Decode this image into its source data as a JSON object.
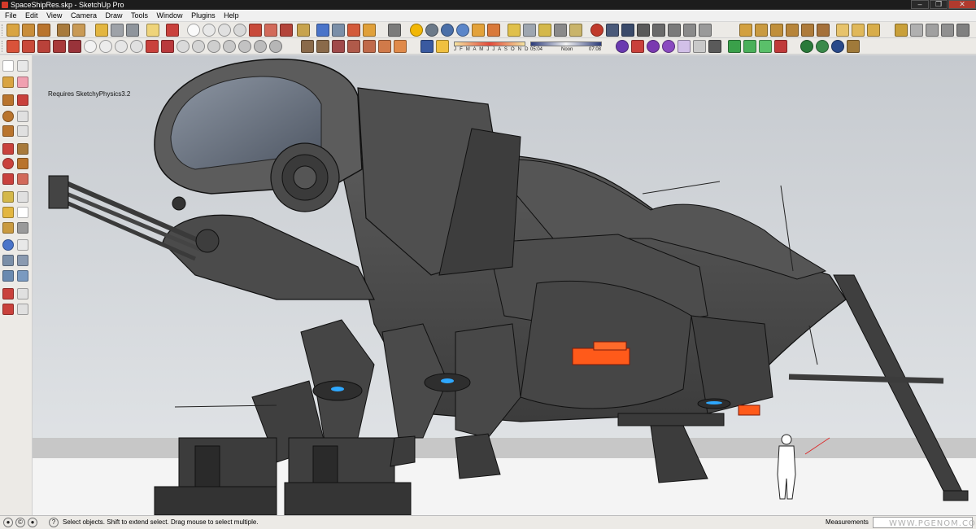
{
  "window": {
    "title": "SpaceShipRes.skp - SketchUp Pro",
    "controls": [
      "–",
      "❐",
      "✕"
    ]
  },
  "menus": [
    "File",
    "Edit",
    "View",
    "Camera",
    "Draw",
    "Tools",
    "Window",
    "Plugins",
    "Help"
  ],
  "shadow_settings": {
    "months": "J F M A M J J A S O N D",
    "time_start": "05:04",
    "time_mid": "Noon",
    "time_end": "07:08"
  },
  "scene": {
    "note": "Requires SketchyPhysics3.2"
  },
  "status": {
    "hint": "Select objects. Shift to extend select. Drag mouse to select multiple.",
    "measurements_label": "Measurements",
    "measurements_value": ""
  },
  "watermark": "WWW.PGENOM.COM",
  "colors": {
    "accent_orange": "#ff5a1a",
    "accent_cyan": "#2ea8ff",
    "hull_dark": "#4b4b4b",
    "sky": "#cbcfd3",
    "ground": "#f4f4f4"
  }
}
